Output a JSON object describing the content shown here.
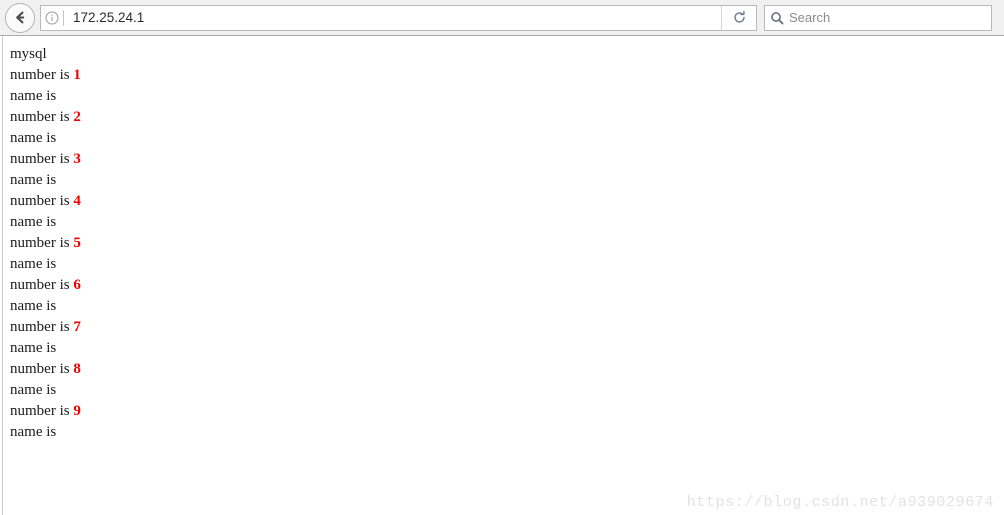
{
  "browser": {
    "back_button_label": "Back",
    "back_icon": "arrow-left-icon",
    "identity_icon": "info-circle-icon",
    "url": "172.25.24.1",
    "url_placeholder": "Search or enter address",
    "reload_icon": "reload-icon",
    "reload_label": "Reload",
    "search": {
      "icon": "search-icon",
      "value": "",
      "placeholder": "Search"
    }
  },
  "page": {
    "lines": [
      {
        "label": "mysql",
        "value": ""
      },
      {
        "label": "number is ",
        "value": "1"
      },
      {
        "label": "name is",
        "value": ""
      },
      {
        "label": "number is ",
        "value": "2"
      },
      {
        "label": "name is",
        "value": ""
      },
      {
        "label": "number is ",
        "value": "3"
      },
      {
        "label": "name is",
        "value": ""
      },
      {
        "label": "number is ",
        "value": "4"
      },
      {
        "label": "name is",
        "value": ""
      },
      {
        "label": "number is ",
        "value": "5"
      },
      {
        "label": "name is",
        "value": ""
      },
      {
        "label": "number is ",
        "value": "6"
      },
      {
        "label": "name is",
        "value": ""
      },
      {
        "label": "number is ",
        "value": "7"
      },
      {
        "label": "name is",
        "value": ""
      },
      {
        "label": "number is ",
        "value": "8"
      },
      {
        "label": "name is",
        "value": ""
      },
      {
        "label": "number is ",
        "value": "9"
      },
      {
        "label": "name is",
        "value": ""
      }
    ],
    "watermark": "https://blog.csdn.net/a939029674",
    "accent_color": "#ee0000"
  }
}
